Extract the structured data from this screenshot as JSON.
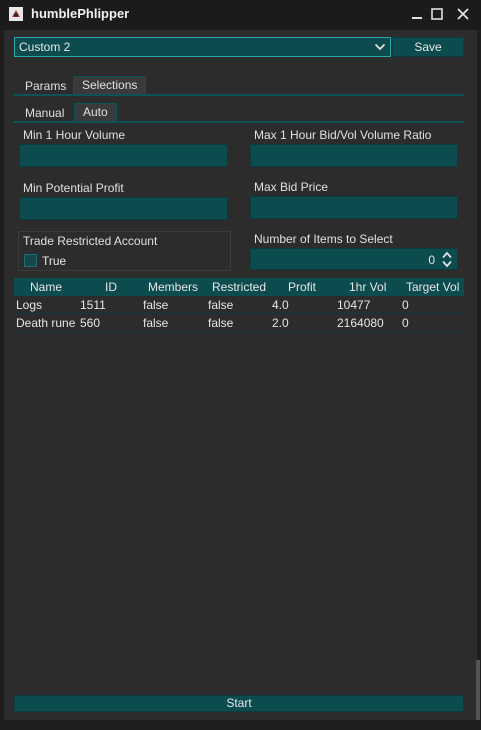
{
  "window": {
    "title": "humblePhlipper"
  },
  "toolbar": {
    "preset_value": "Custom 2",
    "save_label": "Save"
  },
  "tabs": {
    "params": "Params",
    "selections": "Selections"
  },
  "subtabs": {
    "manual": "Manual",
    "auto": "Auto"
  },
  "fields": {
    "min_volume": "Min 1 Hour Volume",
    "max_ratio": "Max 1 Hour Bid/Vol Volume Ratio",
    "min_profit": "Min Potential Profit",
    "max_bid": "Max Bid Price",
    "trade_restricted": "Trade Restricted Account",
    "true_label": "True",
    "num_items": "Number of Items to Select",
    "num_items_value": "0"
  },
  "table": {
    "headers": [
      "Name",
      "ID",
      "Members",
      "Restricted",
      "Profit",
      "1hr Vol",
      "Target Vol"
    ],
    "rows": [
      [
        "Logs",
        "1511",
        "false",
        "false",
        "4.0",
        "10477",
        "0"
      ],
      [
        "Death rune",
        "560",
        "false",
        "false",
        "2.0",
        "2164080",
        "0"
      ]
    ]
  },
  "actions": {
    "start_label": "Start"
  },
  "colors": {
    "accent": "#0c4c4e",
    "accent_border": "#2aa8ad",
    "background": "#2c2c2c",
    "titlebar": "#1b1b1b"
  },
  "icons": {
    "app": "app-logo-icon",
    "minimize": "minimize-icon",
    "maximize": "maximize-icon",
    "close": "close-icon",
    "dropdown": "chevron-down-icon",
    "spinner": "spinner-arrows-icon"
  }
}
